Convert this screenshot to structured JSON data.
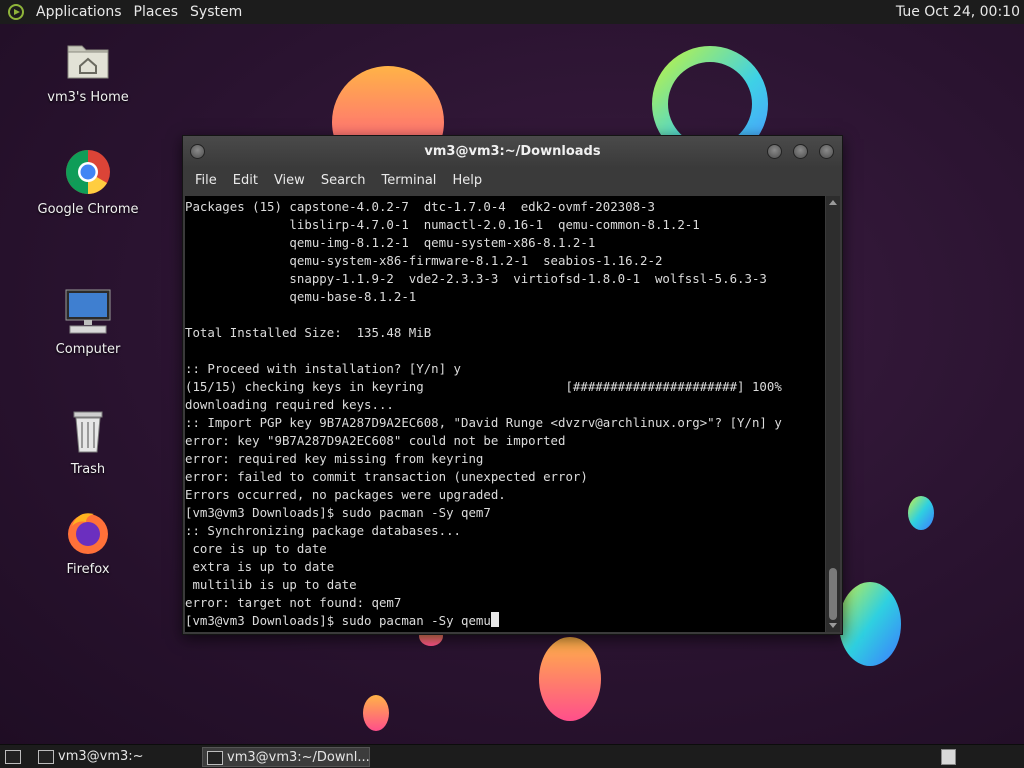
{
  "top_panel": {
    "menus": [
      "Applications",
      "Places",
      "System"
    ],
    "clock": "Tue Oct 24, 00:10"
  },
  "desktop_icons": [
    {
      "label": "vm3's Home",
      "icon": "home-folder-icon"
    },
    {
      "label": "Google Chrome",
      "icon": "chrome-icon"
    },
    {
      "label": "Computer",
      "icon": "computer-icon"
    },
    {
      "label": "Trash",
      "icon": "trash-icon"
    },
    {
      "label": "Firefox",
      "icon": "firefox-icon"
    }
  ],
  "terminal": {
    "title": "vm3@vm3:~/Downloads",
    "menu": [
      "File",
      "Edit",
      "View",
      "Search",
      "Terminal",
      "Help"
    ],
    "lines": [
      "Packages (15) capstone-4.0.2-7  dtc-1.7.0-4  edk2-ovmf-202308-3",
      "              libslirp-4.7.0-1  numactl-2.0.16-1  qemu-common-8.1.2-1",
      "              qemu-img-8.1.2-1  qemu-system-x86-8.1.2-1",
      "              qemu-system-x86-firmware-8.1.2-1  seabios-1.16.2-2",
      "              snappy-1.1.9-2  vde2-2.3.3-3  virtiofsd-1.8.0-1  wolfssl-5.6.3-3",
      "              qemu-base-8.1.2-1",
      "",
      "Total Installed Size:  135.48 MiB",
      "",
      ":: Proceed with installation? [Y/n] y",
      "(15/15) checking keys in keyring                   [######################] 100%",
      "downloading required keys...",
      ":: Import PGP key 9B7A287D9A2EC608, \"David Runge <dvzrv@archlinux.org>\"? [Y/n] y",
      "error: key \"9B7A287D9A2EC608\" could not be imported",
      "error: required key missing from keyring",
      "error: failed to commit transaction (unexpected error)",
      "Errors occurred, no packages were upgraded.",
      "[vm3@vm3 Downloads]$ sudo pacman -Sy qem7",
      ":: Synchronizing package databases...",
      " core is up to date",
      " extra is up to date",
      " multilib is up to date",
      "error: target not found: qem7"
    ],
    "prompt_line": "[vm3@vm3 Downloads]$ sudo pacman -Sy qemu"
  },
  "taskbar": {
    "tasks": [
      {
        "label": "vm3@vm3:~",
        "active": false
      },
      {
        "label": "vm3@vm3:~/Downl...",
        "active": true
      }
    ]
  }
}
